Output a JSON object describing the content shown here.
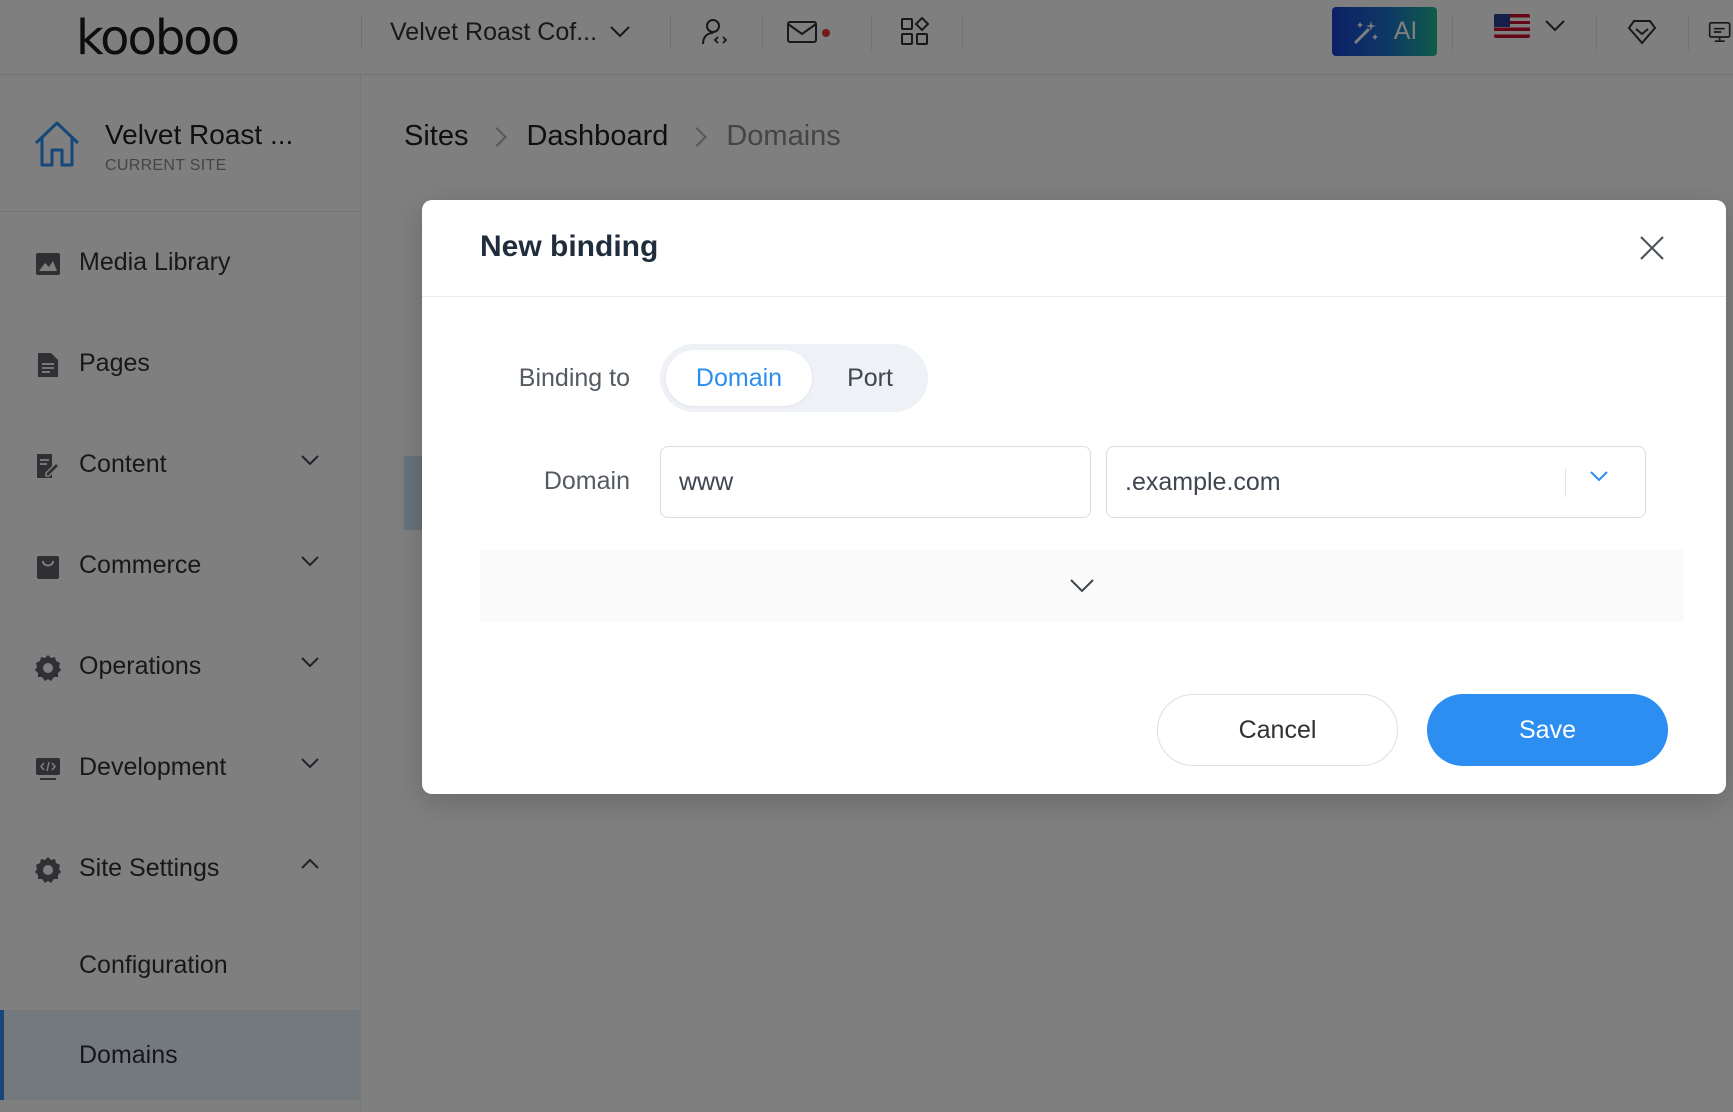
{
  "topbar": {
    "logo": "kooboo",
    "site_selector": "Velvet Roast Cof...",
    "ai_label": "AI",
    "icons": [
      "user-code-icon",
      "mail-icon",
      "apps-icon",
      "diamond-icon",
      "monitor-icon"
    ]
  },
  "sidebar": {
    "current_site": {
      "name": "Velvet Roast ...",
      "subtitle": "CURRENT SITE"
    },
    "items": [
      {
        "label": "Media Library",
        "icon": "image-icon"
      },
      {
        "label": "Pages",
        "icon": "document-icon"
      },
      {
        "label": "Content",
        "icon": "edit-doc-icon",
        "expandable": true
      },
      {
        "label": "Commerce",
        "icon": "bag-icon",
        "expandable": true
      },
      {
        "label": "Operations",
        "icon": "gear-icon",
        "expandable": true
      },
      {
        "label": "Development",
        "icon": "code-icon",
        "expandable": true
      },
      {
        "label": "Site Settings",
        "icon": "gear-icon",
        "expanded": true
      }
    ],
    "sub_items": [
      {
        "label": "Configuration"
      },
      {
        "label": "Domains",
        "active": true
      }
    ]
  },
  "breadcrumb": [
    "Sites",
    "Dashboard",
    "Domains"
  ],
  "dialog": {
    "title": "New binding",
    "binding_to_label": "Binding to",
    "options": [
      "Domain",
      "Port"
    ],
    "selected_option": "Domain",
    "domain_label": "Domain",
    "subdomain_value": "www",
    "root_domain_value": ".example.com",
    "cancel_label": "Cancel",
    "save_label": "Save"
  },
  "colors": {
    "accent": "#2b8ef0",
    "overlay": "rgba(0,0,0,0.5)",
    "ai_gradient_start": "#1a3fd0",
    "ai_gradient_end": "#1fb894"
  }
}
